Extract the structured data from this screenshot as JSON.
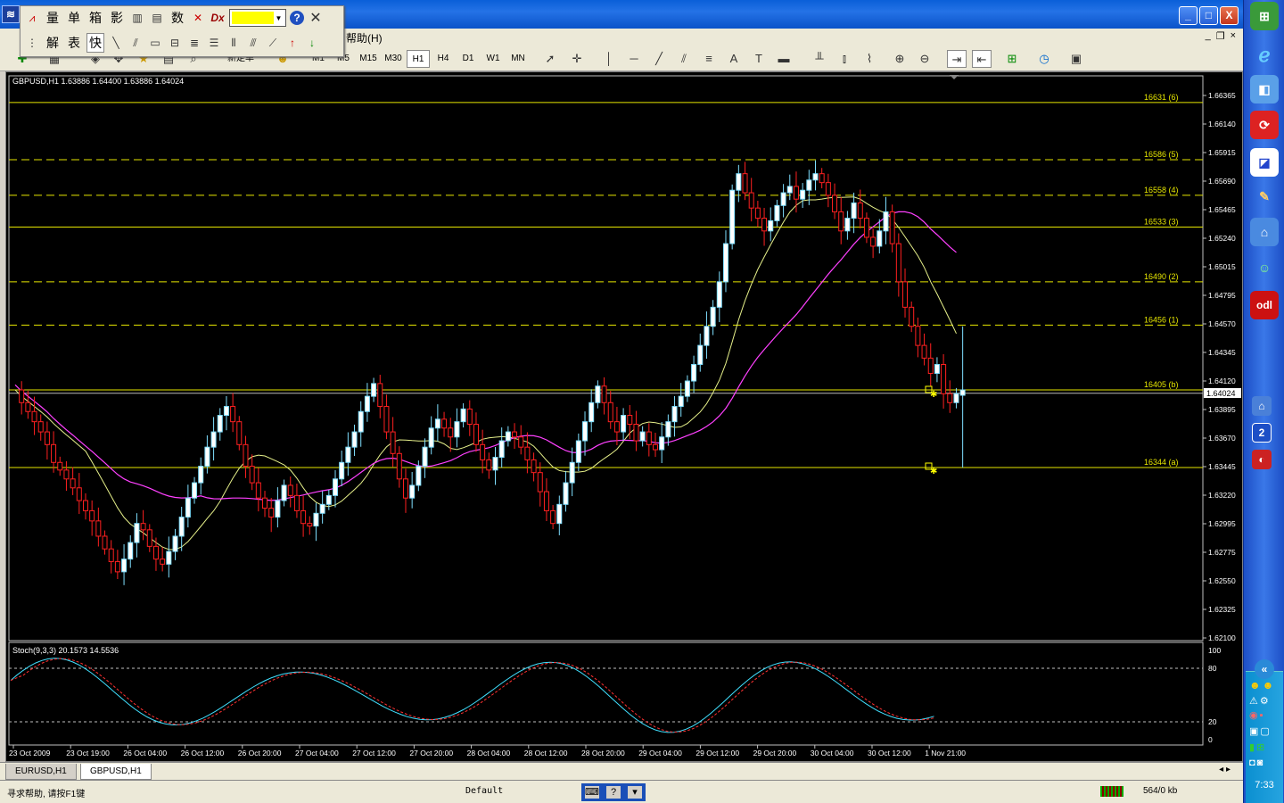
{
  "window": {
    "min_label": "_",
    "max_label": "□",
    "close_label": "X"
  },
  "float_toolbar": {
    "row1": [
      "量",
      "单",
      "箱",
      "影"
    ],
    "row1b": [
      "数"
    ],
    "dx_label": "Dx",
    "row2": [
      "解",
      "表",
      "快"
    ],
    "color": "#ffff00"
  },
  "menu": {
    "visible_item": "帮助(H)",
    "restore_label": "❐",
    "close_label": "×",
    "minimize_label": "_"
  },
  "toolbar": {
    "new_order": "新定单",
    "timeframes": [
      "M1",
      "M5",
      "M15",
      "M30",
      "H1",
      "H4",
      "D1",
      "W1",
      "MN"
    ],
    "active_timeframe": "H1",
    "tool_letters": [
      "A",
      "T"
    ]
  },
  "chart": {
    "header": "GBPUSD,H1  1.63886 1.64400 1.63886 1.64024",
    "current_price": "1.64024",
    "price_axis": [
      "1.66365",
      "1.66140",
      "1.65915",
      "1.65690",
      "1.65465",
      "1.65240",
      "1.65015",
      "1.64795",
      "1.64570",
      "1.64345",
      "1.64120",
      "1.63895",
      "1.63670",
      "1.63445",
      "1.63220",
      "1.62995",
      "1.62775",
      "1.62550",
      "1.62325",
      "1.62100"
    ],
    "levels": [
      {
        "label": "16631 (6)",
        "price": 1.6631,
        "style": "solid"
      },
      {
        "label": "16586 (5)",
        "price": 1.6586,
        "style": "dash"
      },
      {
        "label": "16558 (4)",
        "price": 1.6558,
        "style": "dash"
      },
      {
        "label": "16533 (3)",
        "price": 1.6533,
        "style": "solid"
      },
      {
        "label": "16490 (2)",
        "price": 1.649,
        "style": "dash"
      },
      {
        "label": "16456 (1)",
        "price": 1.6456,
        "style": "dash"
      },
      {
        "label": "16405 (b)",
        "price": 1.6405,
        "style": "solid"
      },
      {
        "label": "16344 (a)",
        "price": 1.6344,
        "style": "solid"
      }
    ],
    "time_axis": [
      "23 Oct 2009",
      "23 Oct 19:00",
      "26 Oct 04:00",
      "26 Oct 12:00",
      "26 Oct 20:00",
      "27 Oct 04:00",
      "27 Oct 12:00",
      "27 Oct 20:00",
      "28 Oct 04:00",
      "28 Oct 12:00",
      "28 Oct 20:00",
      "29 Oct 04:00",
      "29 Oct 12:00",
      "29 Oct 20:00",
      "30 Oct 04:00",
      "30 Oct 12:00",
      "1 Nov 21:00"
    ]
  },
  "stoch": {
    "header": "Stoch(9,3,3) 20.1573 14.5536",
    "scale": [
      "100",
      "80",
      "20",
      "0"
    ]
  },
  "tabs": [
    {
      "label": "EURUSD,H1",
      "active": false
    },
    {
      "label": "GBPUSD,H1",
      "active": true
    }
  ],
  "status": {
    "help": "寻求帮助, 请按F1键",
    "profile": "Default",
    "traffic": "564/0 kb"
  },
  "taskbar": {
    "clock": "7:33"
  }
}
